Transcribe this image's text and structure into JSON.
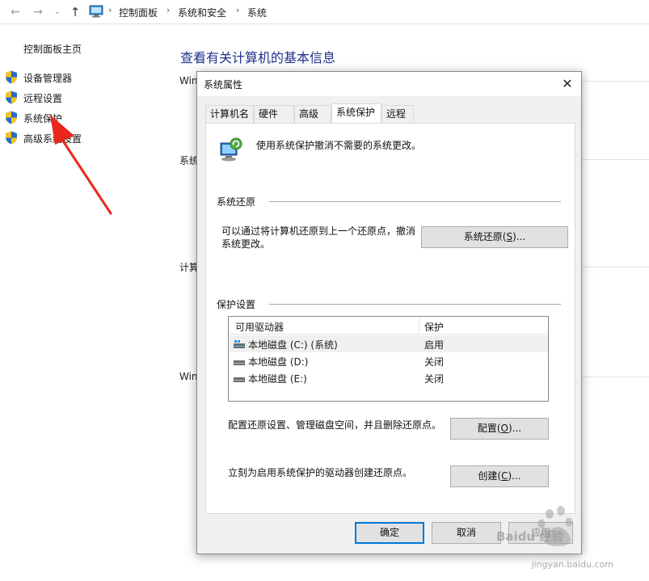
{
  "breadcrumb": {
    "items": [
      "控制面板",
      "系统和安全",
      "系统"
    ]
  },
  "left_nav": {
    "home": "控制面板主页",
    "items": [
      {
        "label": "设备管理器",
        "icon": "uac-shield-icon"
      },
      {
        "label": "远程设置",
        "icon": "uac-shield-icon"
      },
      {
        "label": "系统保护",
        "icon": "uac-shield-icon"
      },
      {
        "label": "高级系统设置",
        "icon": "uac-shield-icon"
      }
    ]
  },
  "main": {
    "title": "查看有关计算机的基本信息",
    "peek_texts": [
      "Win",
      "系统",
      "计算",
      "Win"
    ]
  },
  "dialog": {
    "title": "系统属性",
    "tabs": [
      "计算机名",
      "硬件",
      "高级",
      "系统保护",
      "远程"
    ],
    "active_tab": "系统保护",
    "description": "使用系统保护撤消不需要的系统更改。",
    "restore_group": {
      "label": "系统还原",
      "text_line1": "可以通过将计算机还原到上一个还原点，撤消",
      "text_line2": "系统更改。",
      "button": {
        "before": "系统还原(",
        "key": "S",
        "after": ")..."
      }
    },
    "protection_group": {
      "label": "保护设置",
      "columns": [
        "可用驱动器",
        "保护"
      ],
      "rows": [
        {
          "name": "本地磁盘 (C:) (系统)",
          "state": "启用",
          "icon": "system-drive-icon",
          "selected": true
        },
        {
          "name": "本地磁盘 (D:)",
          "state": "关闭",
          "icon": "drive-icon",
          "selected": false
        },
        {
          "name": "本地磁盘 (E:)",
          "state": "关闭",
          "icon": "drive-icon",
          "selected": false
        }
      ],
      "configure_text": "配置还原设置、管理磁盘空间，并且删除还原点。",
      "configure_button": {
        "before": "配置(",
        "key": "O",
        "after": ")..."
      },
      "create_text": "立刻为启用系统保护的驱动器创建还原点。",
      "create_button": {
        "before": "创建(",
        "key": "C",
        "after": ")..."
      }
    },
    "footer": {
      "ok": "确定",
      "cancel": "取消",
      "apply": "应用"
    }
  },
  "watermark": {
    "brand": "Baidu 经验",
    "url": "jingyan.baidu.com"
  },
  "colors": {
    "title_blue": "#1e3287",
    "default_button_border": "#0078d7",
    "arrow_red": "#e8281e"
  }
}
